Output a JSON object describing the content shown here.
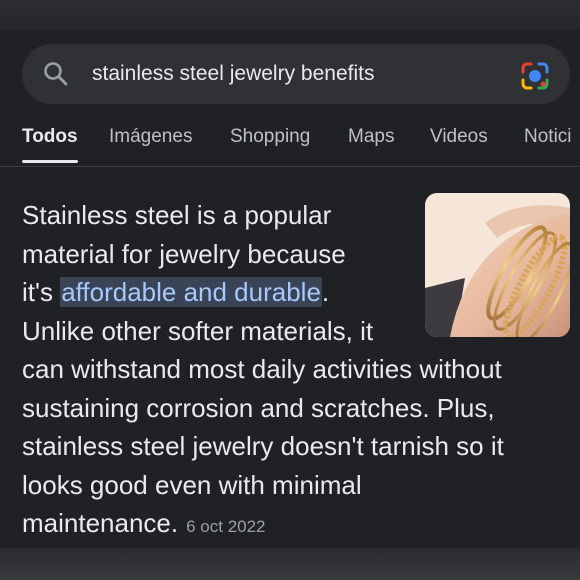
{
  "search": {
    "query": "stainless steel jewelry benefits",
    "icon": "search-icon",
    "lens_icon": "google-lens-icon"
  },
  "tabs": [
    "Todos",
    "Imágenes",
    "Shopping",
    "Maps",
    "Videos",
    "Notici"
  ],
  "snippet": {
    "line1": "Stainless steel is a popular",
    "line2": "material for jewelry because",
    "line3_prefix": "it's ",
    "line3_highlight": "affordable and durable",
    "line3_suffix": ".",
    "line4": "Unlike other softer materials, it",
    "line5": "can withstand most daily activities without",
    "line6": "sustaining corrosion and scratches. Plus,",
    "line7": "stainless steel jewelry doesn't tarnish so it",
    "line8": "looks good even with minimal",
    "line9": "maintenance.",
    "date": "6 oct 2022"
  },
  "image": {
    "subject": "gold-bracelets-on-wrist"
  },
  "colors": {
    "background": "#202124",
    "search_bar": "#303134",
    "highlight_bg": "#394457",
    "highlight_text": "#a8c7fa"
  }
}
